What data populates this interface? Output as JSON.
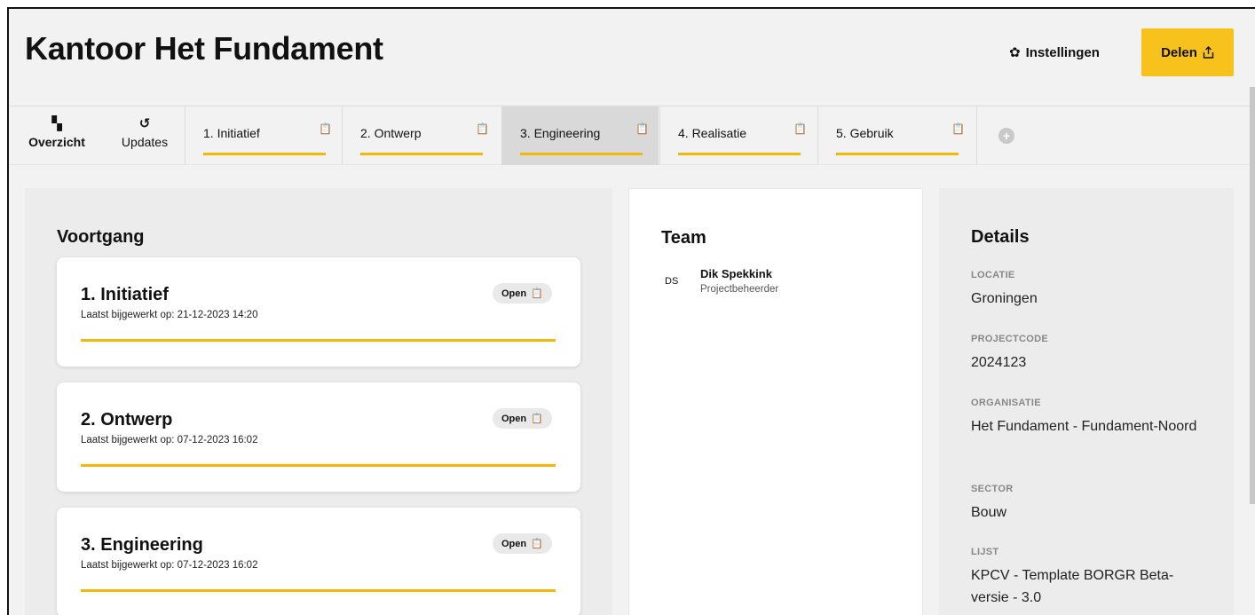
{
  "header": {
    "title": "Kantoor Het Fundament",
    "settings_label": "Instellingen",
    "share_label": "Delen"
  },
  "tabs": {
    "overview_label": "Overzicht",
    "updates_label": "Updates",
    "phases": [
      {
        "label": "1. Initiatief",
        "progress": 1.0,
        "active": false
      },
      {
        "label": "2. Ontwerp",
        "progress": 1.0,
        "active": false
      },
      {
        "label": "3. Engineering",
        "progress": 1.0,
        "active": true
      },
      {
        "label": "4. Realisatie",
        "progress": 1.0,
        "active": false
      },
      {
        "label": "5. Gebruik",
        "progress": 1.0,
        "active": false
      }
    ]
  },
  "voortgang": {
    "title": "Voortgang",
    "cards": [
      {
        "title": "1. Initiatief",
        "updated": "Laatst bijgewerkt op: 21-12-2023 14:20",
        "status": "Open",
        "progress": 1.0
      },
      {
        "title": "2. Ontwerp",
        "updated": "Laatst bijgewerkt op: 07-12-2023 16:02",
        "status": "Open",
        "progress": 1.0
      },
      {
        "title": "3. Engineering",
        "updated": "Laatst bijgewerkt op: 07-12-2023 16:02",
        "status": "Open",
        "progress": 1.0
      }
    ]
  },
  "team": {
    "title": "Team",
    "members": [
      {
        "initials": "DS",
        "name": "Dik Spekkink",
        "role": "Projectbeheerder"
      }
    ]
  },
  "details": {
    "title": "Details",
    "fields": [
      {
        "label": "LOCATIE",
        "value": "Groningen"
      },
      {
        "label": "PROJECTCODE",
        "value": "2024123"
      },
      {
        "label": "ORGANISATIE",
        "value": "Het Fundament - Fundament-Noord"
      },
      {
        "label": "SECTOR",
        "value": "Bouw"
      },
      {
        "label": "LIJST",
        "value": "KPCV - Template BORGR Beta-versie - 3.0"
      }
    ]
  },
  "colors": {
    "accent": "#f7c21b",
    "progress": "#f2b807"
  }
}
